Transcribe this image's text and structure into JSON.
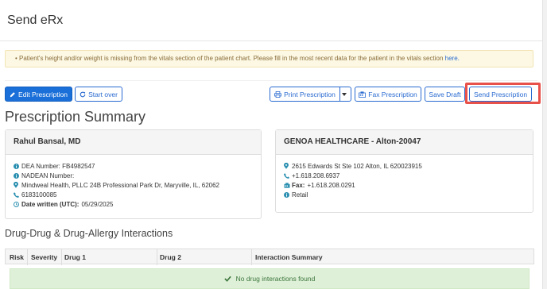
{
  "header": {
    "title": "Send eRx"
  },
  "alert": {
    "message": "• Patient's height and/or weight is missing from the vitals section of the patient chart. Please fill in the most recent data for the patient in the vitals section",
    "link_text": "here."
  },
  "toolbar": {
    "edit_label": "Edit Prescription",
    "start_over_label": "Start over",
    "print_label": "Print Prescription",
    "fax_label": "Fax Prescription",
    "save_draft_label": "Save Draft",
    "send_label": "Send Prescription"
  },
  "summary": {
    "title": "Prescription Summary"
  },
  "prescriber": {
    "name": "Rahul Bansal, MD",
    "dea": "DEA Number: FB4982547",
    "nadean": "NADEAN Number:",
    "address": "Mindweal Health, PLLC 24B Professional Park Dr, Maryville, IL, 62062",
    "phone": "6183100085",
    "date_label": "Date written (UTC):",
    "date_value": "05/29/2025"
  },
  "pharmacy": {
    "name": "GENOA HEALTHCARE - Alton-20047",
    "address": "2615 Edwards St Ste 102 Alton, IL 620023915",
    "phone": "+1.618.208.6937",
    "fax_label": "Fax:",
    "fax_value": "+1.618.208.0291",
    "type": "Retail"
  },
  "interactions": {
    "title": "Drug-Drug & Drug-Allergy Interactions",
    "columns": [
      "Risk",
      "Severity",
      "Drug 1",
      "Drug 2",
      "Interaction Summary"
    ],
    "empty_message": "No drug interactions found"
  },
  "colors": {
    "primary": "#1a6fd8",
    "warning_bg": "#fcf8e3",
    "success_bg": "#dff0d8",
    "highlight": "#e8514a"
  },
  "icons": {
    "edit": "pencil-icon",
    "start_over": "refresh-icon",
    "print": "printer-icon",
    "fax": "fax-icon",
    "info": "info-icon",
    "location": "map-marker-icon",
    "phone": "phone-icon",
    "clock": "clock-icon",
    "check": "check-icon"
  }
}
